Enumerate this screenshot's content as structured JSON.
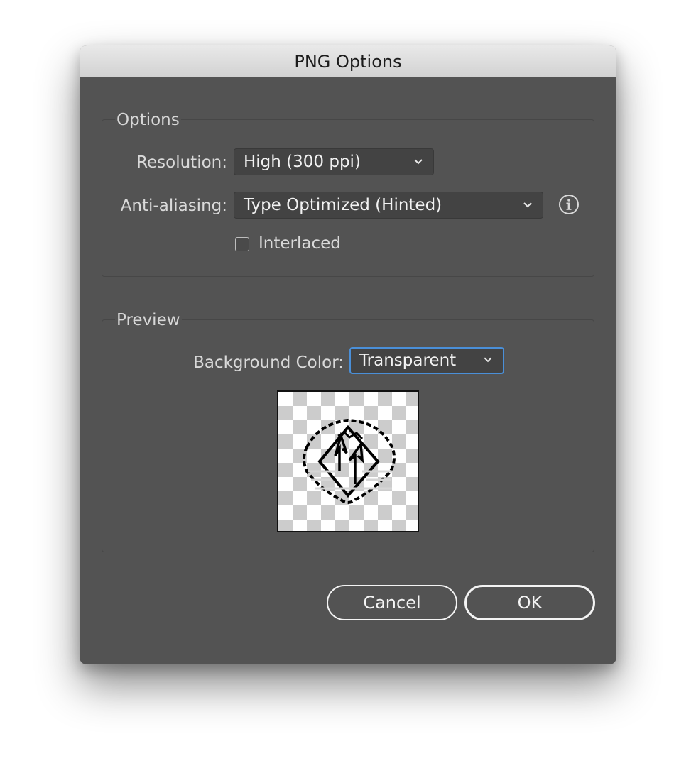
{
  "window": {
    "title": "PNG Options"
  },
  "options_group": {
    "title": "Options",
    "resolution": {
      "label": "Resolution:",
      "value": "High (300 ppi)"
    },
    "anti_aliasing": {
      "label": "Anti-aliasing:",
      "value": "Type Optimized (Hinted)",
      "info_icon": "info-circle-icon"
    },
    "interlaced": {
      "label": "Interlaced",
      "checked": false
    }
  },
  "preview_group": {
    "title": "Preview",
    "background_color": {
      "label": "Background Color:",
      "value": "Transparent"
    }
  },
  "buttons": {
    "cancel": "Cancel",
    "ok": "OK"
  },
  "colors": {
    "dialog_background": "#535353",
    "focus_ring": "#4a8fd8",
    "text": "#d9d9d9"
  }
}
